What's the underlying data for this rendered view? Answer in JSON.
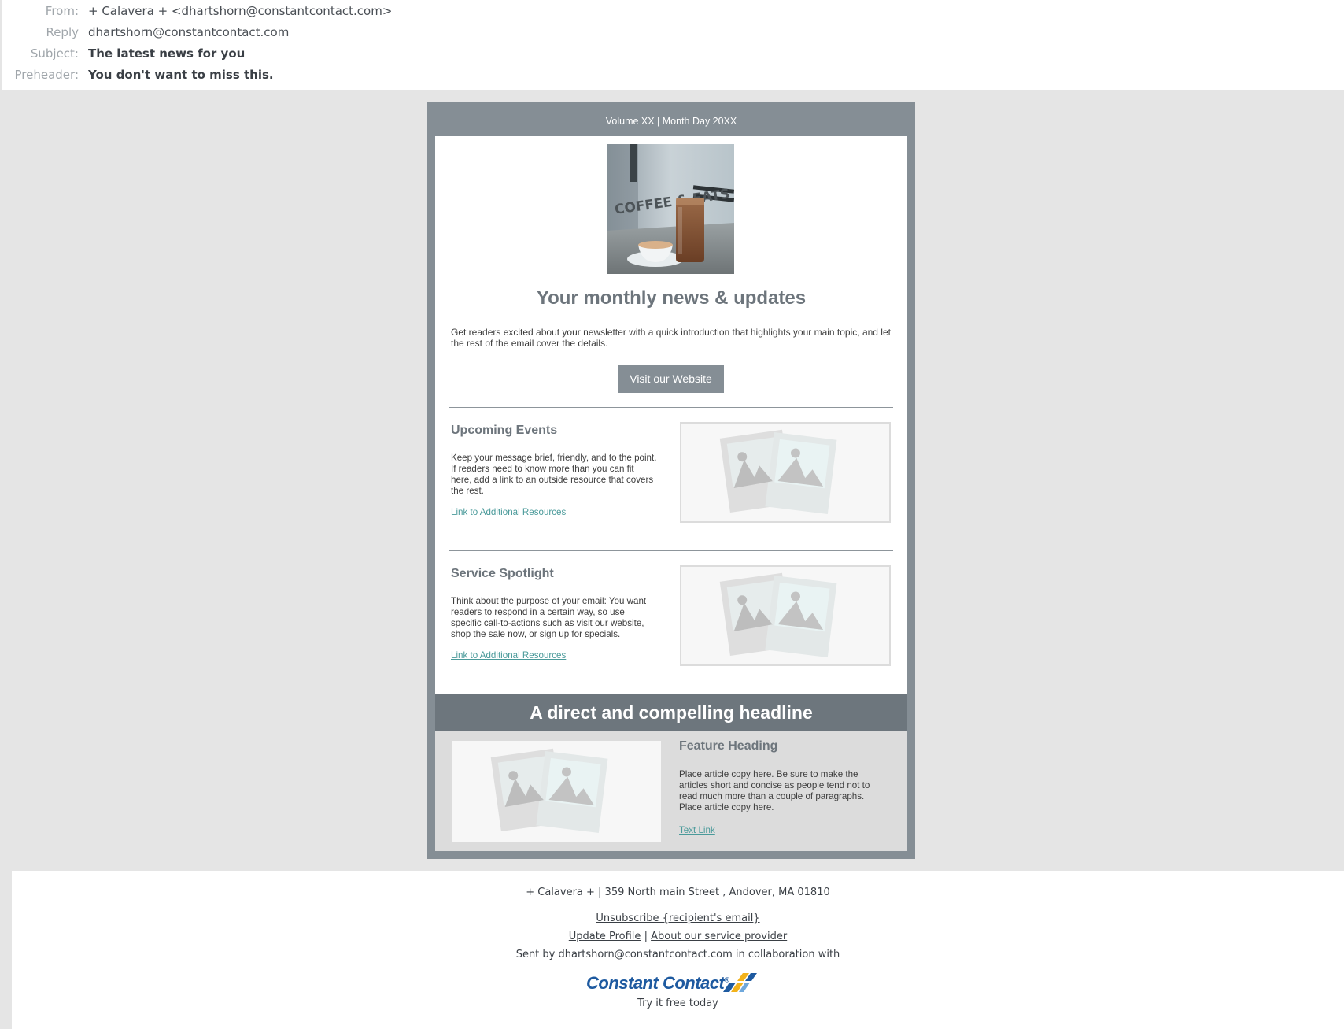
{
  "header": {
    "from_label": "From:",
    "from_value": "+ Calavera + <dhartshorn@constantcontact.com>",
    "reply_label": "Reply",
    "reply_value": "dhartshorn@constantcontact.com",
    "subject_label": "Subject:",
    "subject_value": "The latest news for you",
    "preheader_label": "Preheader:",
    "preheader_value": "You don't want to miss this."
  },
  "newsletter": {
    "volume": "Volume XX | Month Day 20XX",
    "title": "Your monthly news & updates",
    "intro": "Get readers excited about your newsletter with a quick introduction that highlights your main topic, and let the rest of the email cover the details.",
    "cta_label": "Visit our Website",
    "hero_sign_text": "COFFEE & EATS",
    "sections": [
      {
        "heading": "Upcoming Events",
        "body": "Keep your message brief, friendly, and to the point. If readers need to know more than you can fit here, add a link to an outside resource that covers the rest.",
        "link": "Link to Additional Resources"
      },
      {
        "heading": "Service Spotlight",
        "body": "Think about the purpose of your email: You want readers to respond in a certain way, so use specific call-to-actions such as visit our website, shop the sale now, or sign up for specials.",
        "link": "Link to Additional Resources"
      }
    ],
    "headline": "A direct and compelling headline",
    "feature": {
      "heading": "Feature Heading",
      "body": "Place article copy here. Be sure to make the articles short and concise as people tend not to read much more than a couple of paragraphs. Place article copy here.",
      "link": "Text Link"
    }
  },
  "footer": {
    "address": "+ Calavera + | 359 North main Street , Andover, MA 01810",
    "unsubscribe": "Unsubscribe {recipient's email}",
    "update_profile": "Update Profile",
    "separator": "|",
    "about_provider": "About our service provider",
    "sent_by": "Sent by dhartshorn@constantcontact.com in collaboration with",
    "logo_text": "Constant Contact",
    "logo_mark": "®",
    "try_free": "Try it free today"
  },
  "colors": {
    "frame": "#858e95",
    "headline_bar": "#6d767d",
    "link": "#4a9a9a",
    "logo_blue": "#1e5aa0"
  }
}
